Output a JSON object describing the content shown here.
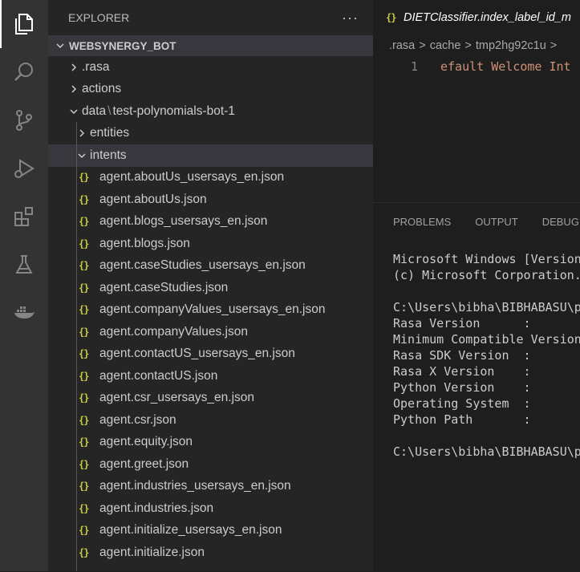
{
  "colors": {
    "activity_bar": "#333333",
    "sidebar": "#252526",
    "selection": "#37373d",
    "editor": "#1e1e1e",
    "json_icon": "#cbcb41",
    "code_string": "#ce9178"
  },
  "activity_bar": {
    "items": [
      {
        "name": "explorer-icon",
        "active": true
      },
      {
        "name": "search-icon"
      },
      {
        "name": "source-control-icon"
      },
      {
        "name": "run-debug-icon"
      },
      {
        "name": "extensions-icon"
      },
      {
        "name": "testing-icon"
      },
      {
        "name": "docker-icon"
      }
    ]
  },
  "sidebar": {
    "title": "EXPLORER",
    "more_label": "···",
    "root": "WEBSYNERGY_BOT",
    "folders": {
      "rasa": ".rasa",
      "actions": "actions",
      "data": "data",
      "data_sub": "test-polynomials-bot-1",
      "path_sep": "\\",
      "entities": "entities",
      "intents": "intents"
    },
    "json_icon": "{}",
    "files": [
      "agent.aboutUs_usersays_en.json",
      "agent.aboutUs.json",
      "agent.blogs_usersays_en.json",
      "agent.blogs.json",
      "agent.caseStudies_usersays_en.json",
      "agent.caseStudies.json",
      "agent.companyValues_usersays_en.json",
      "agent.companyValues.json",
      "agent.contactUS_usersays_en.json",
      "agent.contactUS.json",
      "agent.csr_usersays_en.json",
      "agent.csr.json",
      "agent.equity.json",
      "agent.greet.json",
      "agent.industries_usersays_en.json",
      "agent.industries.json",
      "agent.initialize_usersays_en.json",
      "agent.initialize.json"
    ]
  },
  "editor": {
    "tab_title": "DIETClassifier.index_label_id_m",
    "breadcrumb": [
      ".rasa",
      "cache",
      "tmp2hg92c1u"
    ],
    "breadcrumb_sep": ">",
    "line_number": "1",
    "line_text": "efault Welcome Int"
  },
  "panel": {
    "tabs": [
      "PROBLEMS",
      "OUTPUT",
      "DEBUG C"
    ],
    "terminal_lines": [
      "Microsoft Windows [Version",
      "(c) Microsoft Corporation.",
      "",
      "C:\\Users\\bibha\\BIBHABASU\\p",
      "Rasa Version      :",
      "Minimum Compatible Version",
      "Rasa SDK Version  :",
      "Rasa X Version    :",
      "Python Version    :",
      "Operating System  :",
      "Python Path       :",
      "",
      "C:\\Users\\bibha\\BIBHABASU\\p"
    ]
  }
}
